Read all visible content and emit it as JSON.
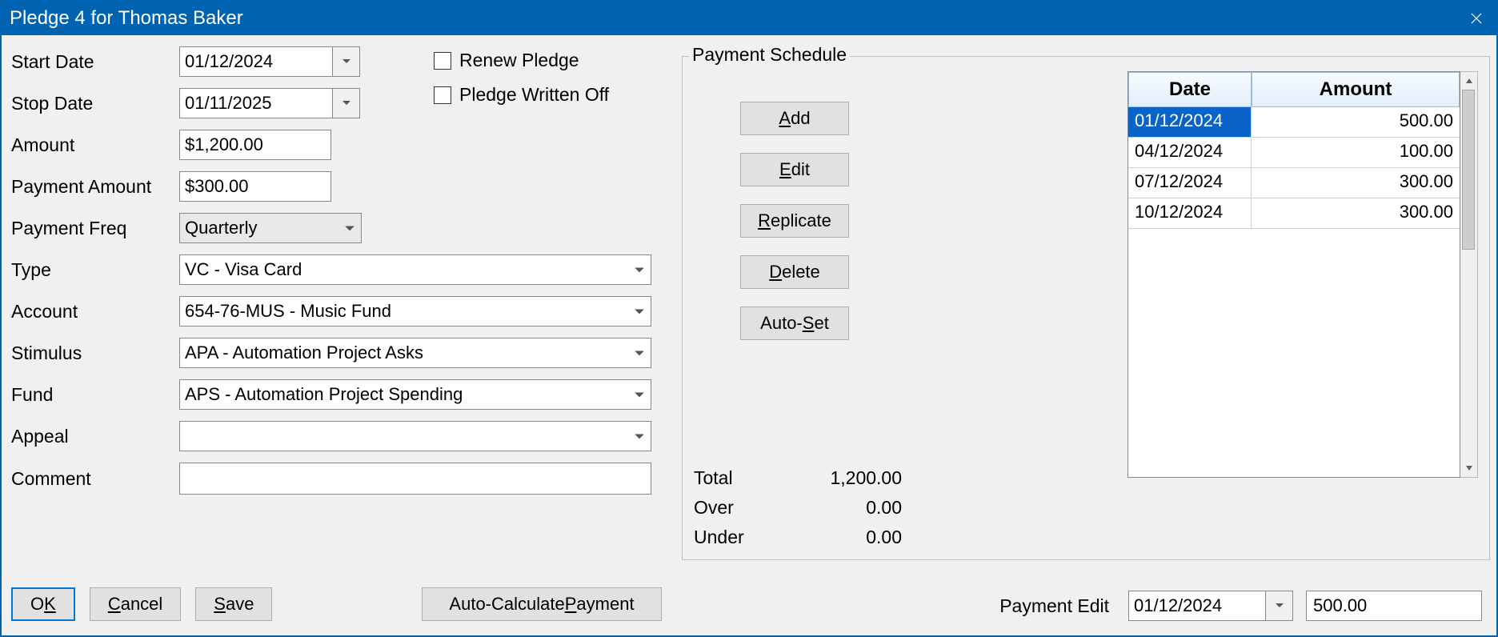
{
  "window": {
    "title": "Pledge 4 for Thomas Baker"
  },
  "labels": {
    "start_date": "Start Date",
    "stop_date": "Stop Date",
    "amount": "Amount",
    "payment_amount": "Payment Amount",
    "payment_freq": "Payment Freq",
    "type": "Type",
    "account": "Account",
    "stimulus": "Stimulus",
    "fund": "Fund",
    "appeal": "Appeal",
    "comment": "Comment",
    "renew": "Renew Pledge",
    "written_off": "Pledge Written Off",
    "payment_schedule": "Payment Schedule",
    "total": "Total",
    "over": "Over",
    "under": "Under",
    "payment_edit": "Payment Edit",
    "col_date": "Date",
    "col_amount": "Amount"
  },
  "fields": {
    "start_date": "01/12/2024",
    "stop_date": "01/11/2025",
    "amount": "$1,200.00",
    "payment_amount": "$300.00",
    "payment_freq": "Quarterly",
    "type": "VC - Visa Card",
    "account": "654-76-MUS - Music Fund",
    "stimulus": "APA - Automation Project Asks",
    "fund": "APS - Automation Project Spending",
    "appeal": "",
    "comment": ""
  },
  "schedule": [
    {
      "date": "01/12/2024",
      "amount": "500.00",
      "selected": true
    },
    {
      "date": "04/12/2024",
      "amount": "100.00",
      "selected": false
    },
    {
      "date": "07/12/2024",
      "amount": "300.00",
      "selected": false
    },
    {
      "date": "10/12/2024",
      "amount": "300.00",
      "selected": false
    }
  ],
  "totals": {
    "total": "1,200.00",
    "over": "0.00",
    "under": "0.00"
  },
  "payment_edit": {
    "date": "01/12/2024",
    "amount": "500.00"
  },
  "buttons": {
    "ok_pre": "O",
    "ok_u": "K",
    "cancel_u": "C",
    "cancel_post": "ancel",
    "save_u": "S",
    "save_post": "ave",
    "autocalc_pre": "Auto-Calculate ",
    "autocalc_u": "P",
    "autocalc_post": "ayment",
    "add_u": "A",
    "add_post": "dd",
    "edit_u": "E",
    "edit_post": "dit",
    "rep_u": "R",
    "rep_post": "eplicate",
    "del_u": "D",
    "del_post": "elete",
    "auto_pre": "Auto-",
    "auto_u": "S",
    "auto_post": "et"
  }
}
